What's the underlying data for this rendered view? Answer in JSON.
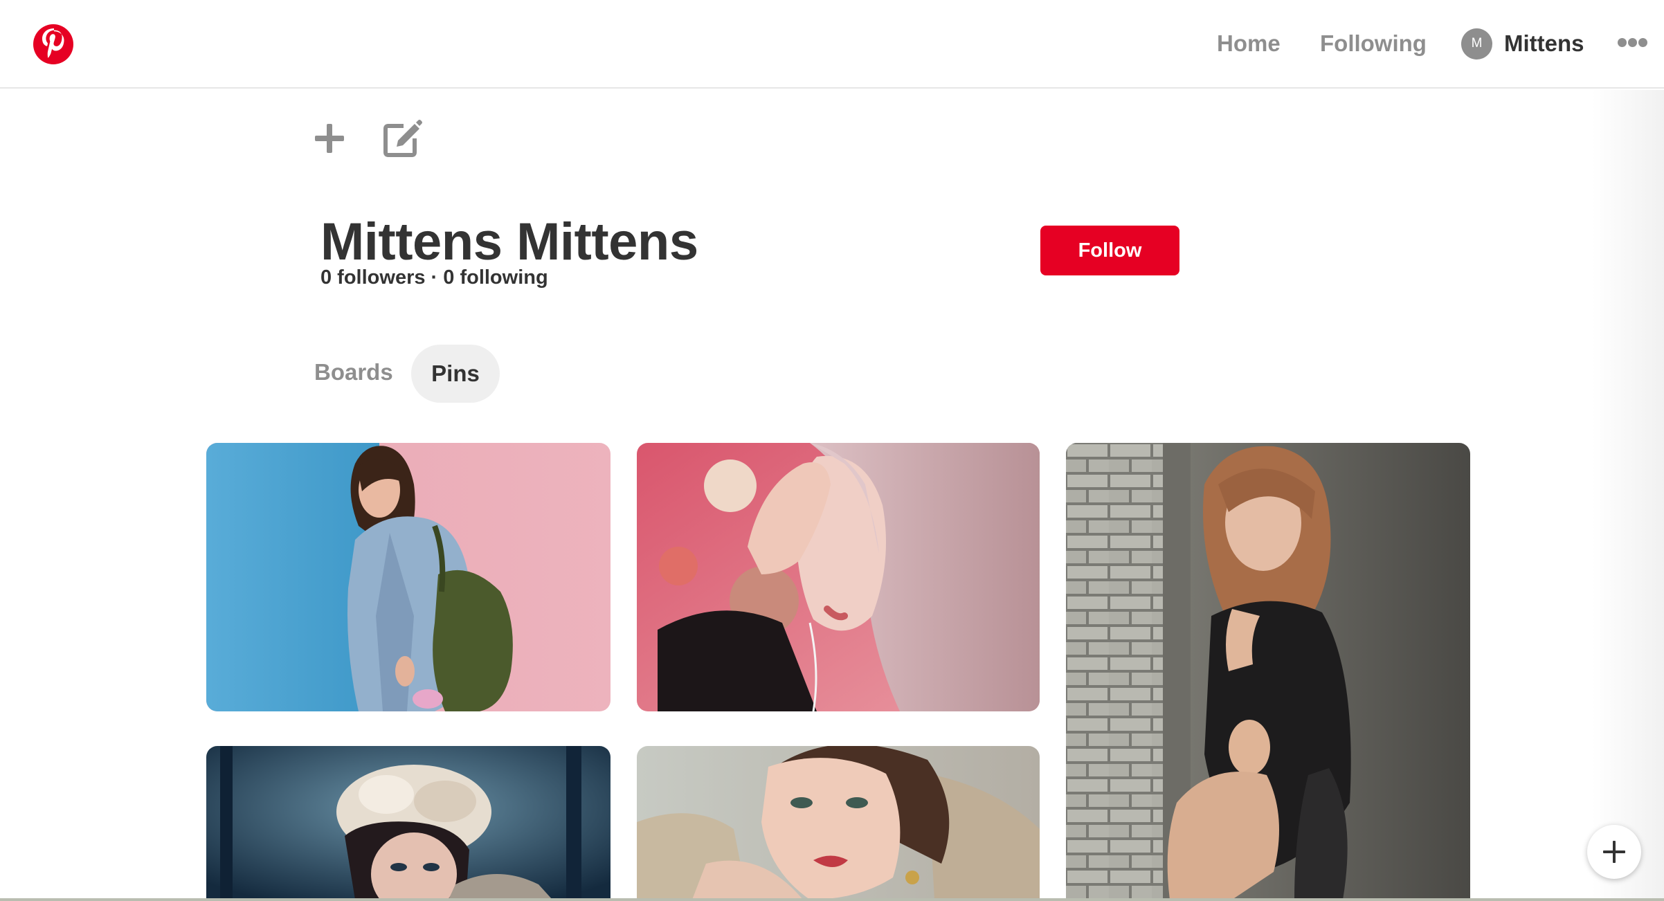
{
  "header": {
    "logo": "pinterest-logo",
    "nav": {
      "home_label": "Home",
      "following_label": "Following",
      "user_initial": "M",
      "user_name": "Mittens"
    },
    "more_icon": "ellipsis-icon"
  },
  "toolbar": {
    "add_icon": "plus-icon",
    "edit_icon": "edit-icon"
  },
  "profile": {
    "name": "Mittens Mittens",
    "stats": "0 followers · 0 following",
    "follow_label": "Follow"
  },
  "tabs": [
    {
      "label": "Boards",
      "active": false
    },
    {
      "label": "Pins",
      "active": true
    }
  ],
  "pins": [
    {
      "subject": "woman in denim jacket with backpack against blue and pink wall"
    },
    {
      "subject": "woman with pink hair beside pastel cotton ball lights"
    },
    {
      "subject": "woman in black dress seated against brick and concrete wall"
    },
    {
      "subject": "woman wearing white fur hat in blue forest"
    },
    {
      "subject": "woman with red lipstick and gold earring"
    }
  ],
  "colors": {
    "brand_red": "#e60023",
    "nav_gray": "#8e8e8e",
    "text_dark": "#333333",
    "tab_active_bg": "#efefef"
  },
  "fab_icon": "plus-icon"
}
